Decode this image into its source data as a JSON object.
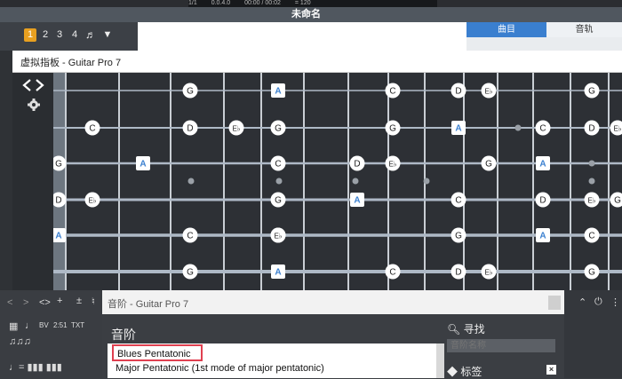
{
  "transport": {
    "bar": "1/1",
    "time": "0.0.4.0",
    "clock": "00:00 / 00:02",
    "tempo": "= 120"
  },
  "document": {
    "title": "未命名"
  },
  "toolbar": {
    "tracks": [
      "1",
      "2",
      "3",
      "4"
    ]
  },
  "right_panel": {
    "tab_song": "曲目",
    "tab_track": "音轨"
  },
  "fretboard": {
    "window_title": "虚拟指板 - Guitar Pro 7",
    "notes": [
      {
        "string": 1,
        "pos": "f2",
        "label": "G"
      },
      {
        "string": 1,
        "pos": "f4",
        "label": "A",
        "root": true
      },
      {
        "string": 1,
        "pos": "f7",
        "label": "C"
      },
      {
        "string": 1,
        "pos": "f9",
        "label": "D"
      },
      {
        "string": 1,
        "pos": "f10",
        "label": "E♭"
      },
      {
        "string": 1,
        "pos": "f12",
        "label": "G"
      },
      {
        "string": 2,
        "pos": "f0",
        "label": "C"
      },
      {
        "string": 2,
        "pos": "f2",
        "label": "D"
      },
      {
        "string": 2,
        "pos": "f3",
        "label": "E♭"
      },
      {
        "string": 2,
        "pos": "f5",
        "label": "G"
      },
      {
        "string": 2,
        "pos": "f7",
        "label": "G"
      },
      {
        "string": 2,
        "pos": "f9",
        "label": "A",
        "root": true
      },
      {
        "string": 2,
        "pos": "f11",
        "label": "C"
      },
      {
        "string": 2,
        "pos": "f12",
        "label": "D"
      },
      {
        "string": 2,
        "pos": "f13",
        "label": "E♭"
      },
      {
        "string": 3,
        "pos": "nut",
        "label": "G"
      },
      {
        "string": 3,
        "pos": "f1",
        "label": "A",
        "root": true
      },
      {
        "string": 3,
        "pos": "f4",
        "label": "C"
      },
      {
        "string": 3,
        "pos": "f6",
        "label": "D"
      },
      {
        "string": 3,
        "pos": "f7",
        "label": "E♭"
      },
      {
        "string": 3,
        "pos": "f10",
        "label": "G"
      },
      {
        "string": 3,
        "pos": "f11",
        "label": "A",
        "root": true
      },
      {
        "string": 4,
        "pos": "nut",
        "label": "D"
      },
      {
        "string": 4,
        "pos": "f0",
        "label": "E♭"
      },
      {
        "string": 4,
        "pos": "f4",
        "label": "G"
      },
      {
        "string": 4,
        "pos": "f6",
        "label": "A",
        "root": true
      },
      {
        "string": 4,
        "pos": "f9",
        "label": "C"
      },
      {
        "string": 4,
        "pos": "f11",
        "label": "D"
      },
      {
        "string": 4,
        "pos": "f12",
        "label": "E♭"
      },
      {
        "string": 4,
        "pos": "f13",
        "label": "G"
      },
      {
        "string": 5,
        "pos": "nut",
        "label": "A",
        "root": true
      },
      {
        "string": 5,
        "pos": "f2",
        "label": "C"
      },
      {
        "string": 5,
        "pos": "f4",
        "label": "D"
      },
      {
        "string": 5,
        "pos": "f5",
        "label": "E♭"
      },
      {
        "string": 5,
        "pos": "f9",
        "label": "G"
      },
      {
        "string": 5,
        "pos": "f11",
        "label": "A",
        "root": true
      },
      {
        "string": 5,
        "pos": "f12",
        "label": "C"
      },
      {
        "string": 6,
        "pos": "f2",
        "label": "G"
      },
      {
        "string": 6,
        "pos": "f4",
        "label": "A",
        "root": true
      },
      {
        "string": 6,
        "pos": "f7",
        "label": "C"
      },
      {
        "string": 6,
        "pos": "f9",
        "label": "D"
      },
      {
        "string": 6,
        "pos": "f10",
        "label": "E♭"
      },
      {
        "string": 6,
        "pos": "f12",
        "label": "G"
      }
    ]
  },
  "scale_window": {
    "title": "音阶 - Guitar Pro 7",
    "heading": "音阶",
    "items": [
      "Blues Pentatonic",
      "Major Pentatonic (1st mode of major pentatonic)"
    ],
    "selected": "Blues Pentatonic",
    "search_heading": "寻找",
    "search_placeholder": "音阶名称",
    "tags_heading": "标签"
  },
  "colors": {
    "accent": "#3a7fcf",
    "highlight": "#e8a020",
    "selection_border": "#e04050",
    "root_note": "#ffffff"
  }
}
